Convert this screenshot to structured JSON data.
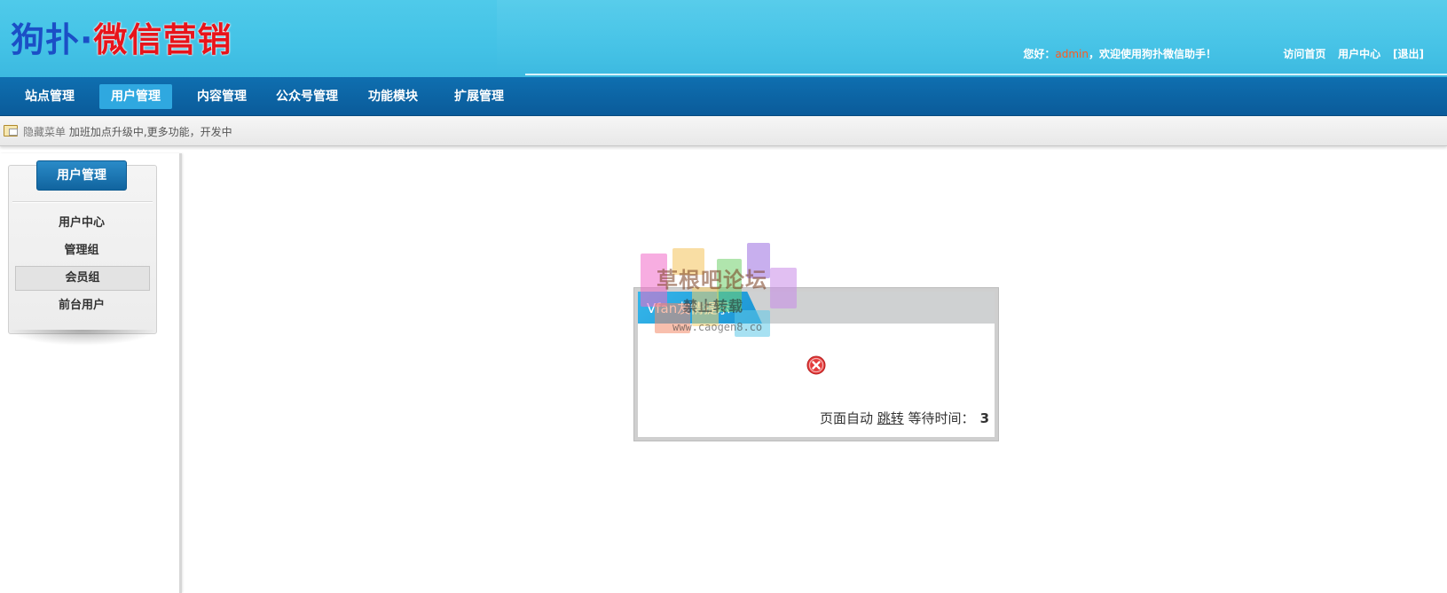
{
  "header": {
    "logo": {
      "part1": "狗扑",
      "dot": "·",
      "part2": "微信营销"
    },
    "welcome": {
      "prefix": "您好：",
      "username": "admin",
      "suffix": "，欢迎使用狗扑微信助手！"
    },
    "links": {
      "home": "访问首页",
      "user_center": "用户中心",
      "logout": "[退出]"
    }
  },
  "nav": {
    "items": [
      {
        "label": "站点管理"
      },
      {
        "label": "用户管理"
      },
      {
        "label": "内容管理"
      },
      {
        "label": "公众号管理"
      },
      {
        "label": "功能模块"
      },
      {
        "label": "扩展管理"
      }
    ],
    "active": "用户管理"
  },
  "subbar": {
    "hide_menu": "隐藏菜单",
    "notice": "加班加点升级中,更多功能，开发中"
  },
  "sidebar": {
    "title": "用户管理",
    "items": [
      {
        "label": "用户中心"
      },
      {
        "label": "管理组"
      },
      {
        "label": "会员组"
      },
      {
        "label": "前台用户"
      }
    ],
    "active": "会员组"
  },
  "dialog": {
    "title": "Vfan友情提示",
    "message_prefix": "页面自动",
    "jump_link": "跳转",
    "message_wait": "等待时间：",
    "countdown": "3"
  },
  "watermark": {
    "text": "草根吧论坛",
    "subtext": "禁止转载",
    "url": "www.caogen8.co"
  },
  "colors": {
    "header_bg": "#43c2e6",
    "nav_bg": "#0a5b9a",
    "nav_active": "#2fa8e0",
    "username": "#ff5a1f",
    "error": "#e43b3b"
  }
}
